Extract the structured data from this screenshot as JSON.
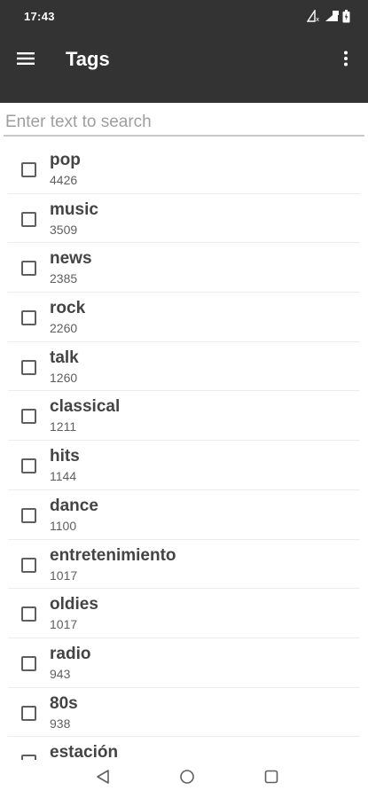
{
  "status_bar": {
    "time": "17:43",
    "icons": [
      "signal-icon",
      "wifi-signal-icon",
      "battery-icon"
    ]
  },
  "app_bar": {
    "title": "Tags",
    "menu_icon": "hamburger-menu-icon",
    "overflow_icon": "more-vert-icon"
  },
  "search": {
    "placeholder": "Enter text to search",
    "value": ""
  },
  "tags": [
    {
      "name": "pop",
      "count": "4426",
      "checked": false
    },
    {
      "name": "music",
      "count": "3509",
      "checked": false
    },
    {
      "name": "news",
      "count": "2385",
      "checked": false
    },
    {
      "name": "rock",
      "count": "2260",
      "checked": false
    },
    {
      "name": "talk",
      "count": "1260",
      "checked": false
    },
    {
      "name": "classical",
      "count": "1211",
      "checked": false
    },
    {
      "name": "hits",
      "count": "1144",
      "checked": false
    },
    {
      "name": "dance",
      "count": "1100",
      "checked": false
    },
    {
      "name": "entretenimiento",
      "count": "1017",
      "checked": false
    },
    {
      "name": "oldies",
      "count": "1017",
      "checked": false
    },
    {
      "name": "radio",
      "count": "943",
      "checked": false
    },
    {
      "name": "80s",
      "count": "938",
      "checked": false
    },
    {
      "name": "estación",
      "count": "",
      "checked": false
    }
  ],
  "nav_bar": {
    "back_icon": "back-triangle-icon",
    "home_icon": "home-circle-icon",
    "recents_icon": "recents-square-icon"
  },
  "colors": {
    "app_bar_bg": "#333333",
    "text_primary": "#444444",
    "text_secondary": "#5f5f5f",
    "divider": "#ececec",
    "placeholder": "#9e9e9e"
  }
}
